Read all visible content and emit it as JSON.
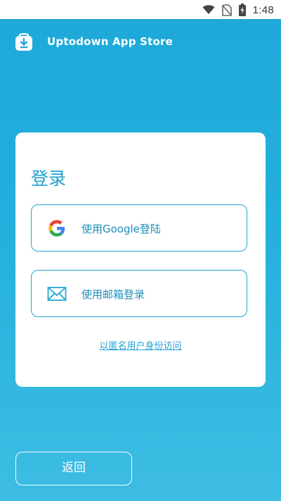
{
  "status_bar": {
    "time": "1:48",
    "icons": [
      "wifi-icon",
      "no-sim-icon",
      "battery-charging-icon"
    ]
  },
  "header": {
    "title": "Uptodown App Store",
    "logo_icon": "uptodown-logo-icon"
  },
  "login_card": {
    "title": "登录",
    "google_button_label": "使用Google登陆",
    "email_button_label": "使用邮箱登录",
    "anonymous_link": "以匿名用户身份访问"
  },
  "back_button_label": "返回",
  "colors": {
    "background": "#24b0dc",
    "accent": "#1e9fce",
    "card": "#ffffff"
  }
}
